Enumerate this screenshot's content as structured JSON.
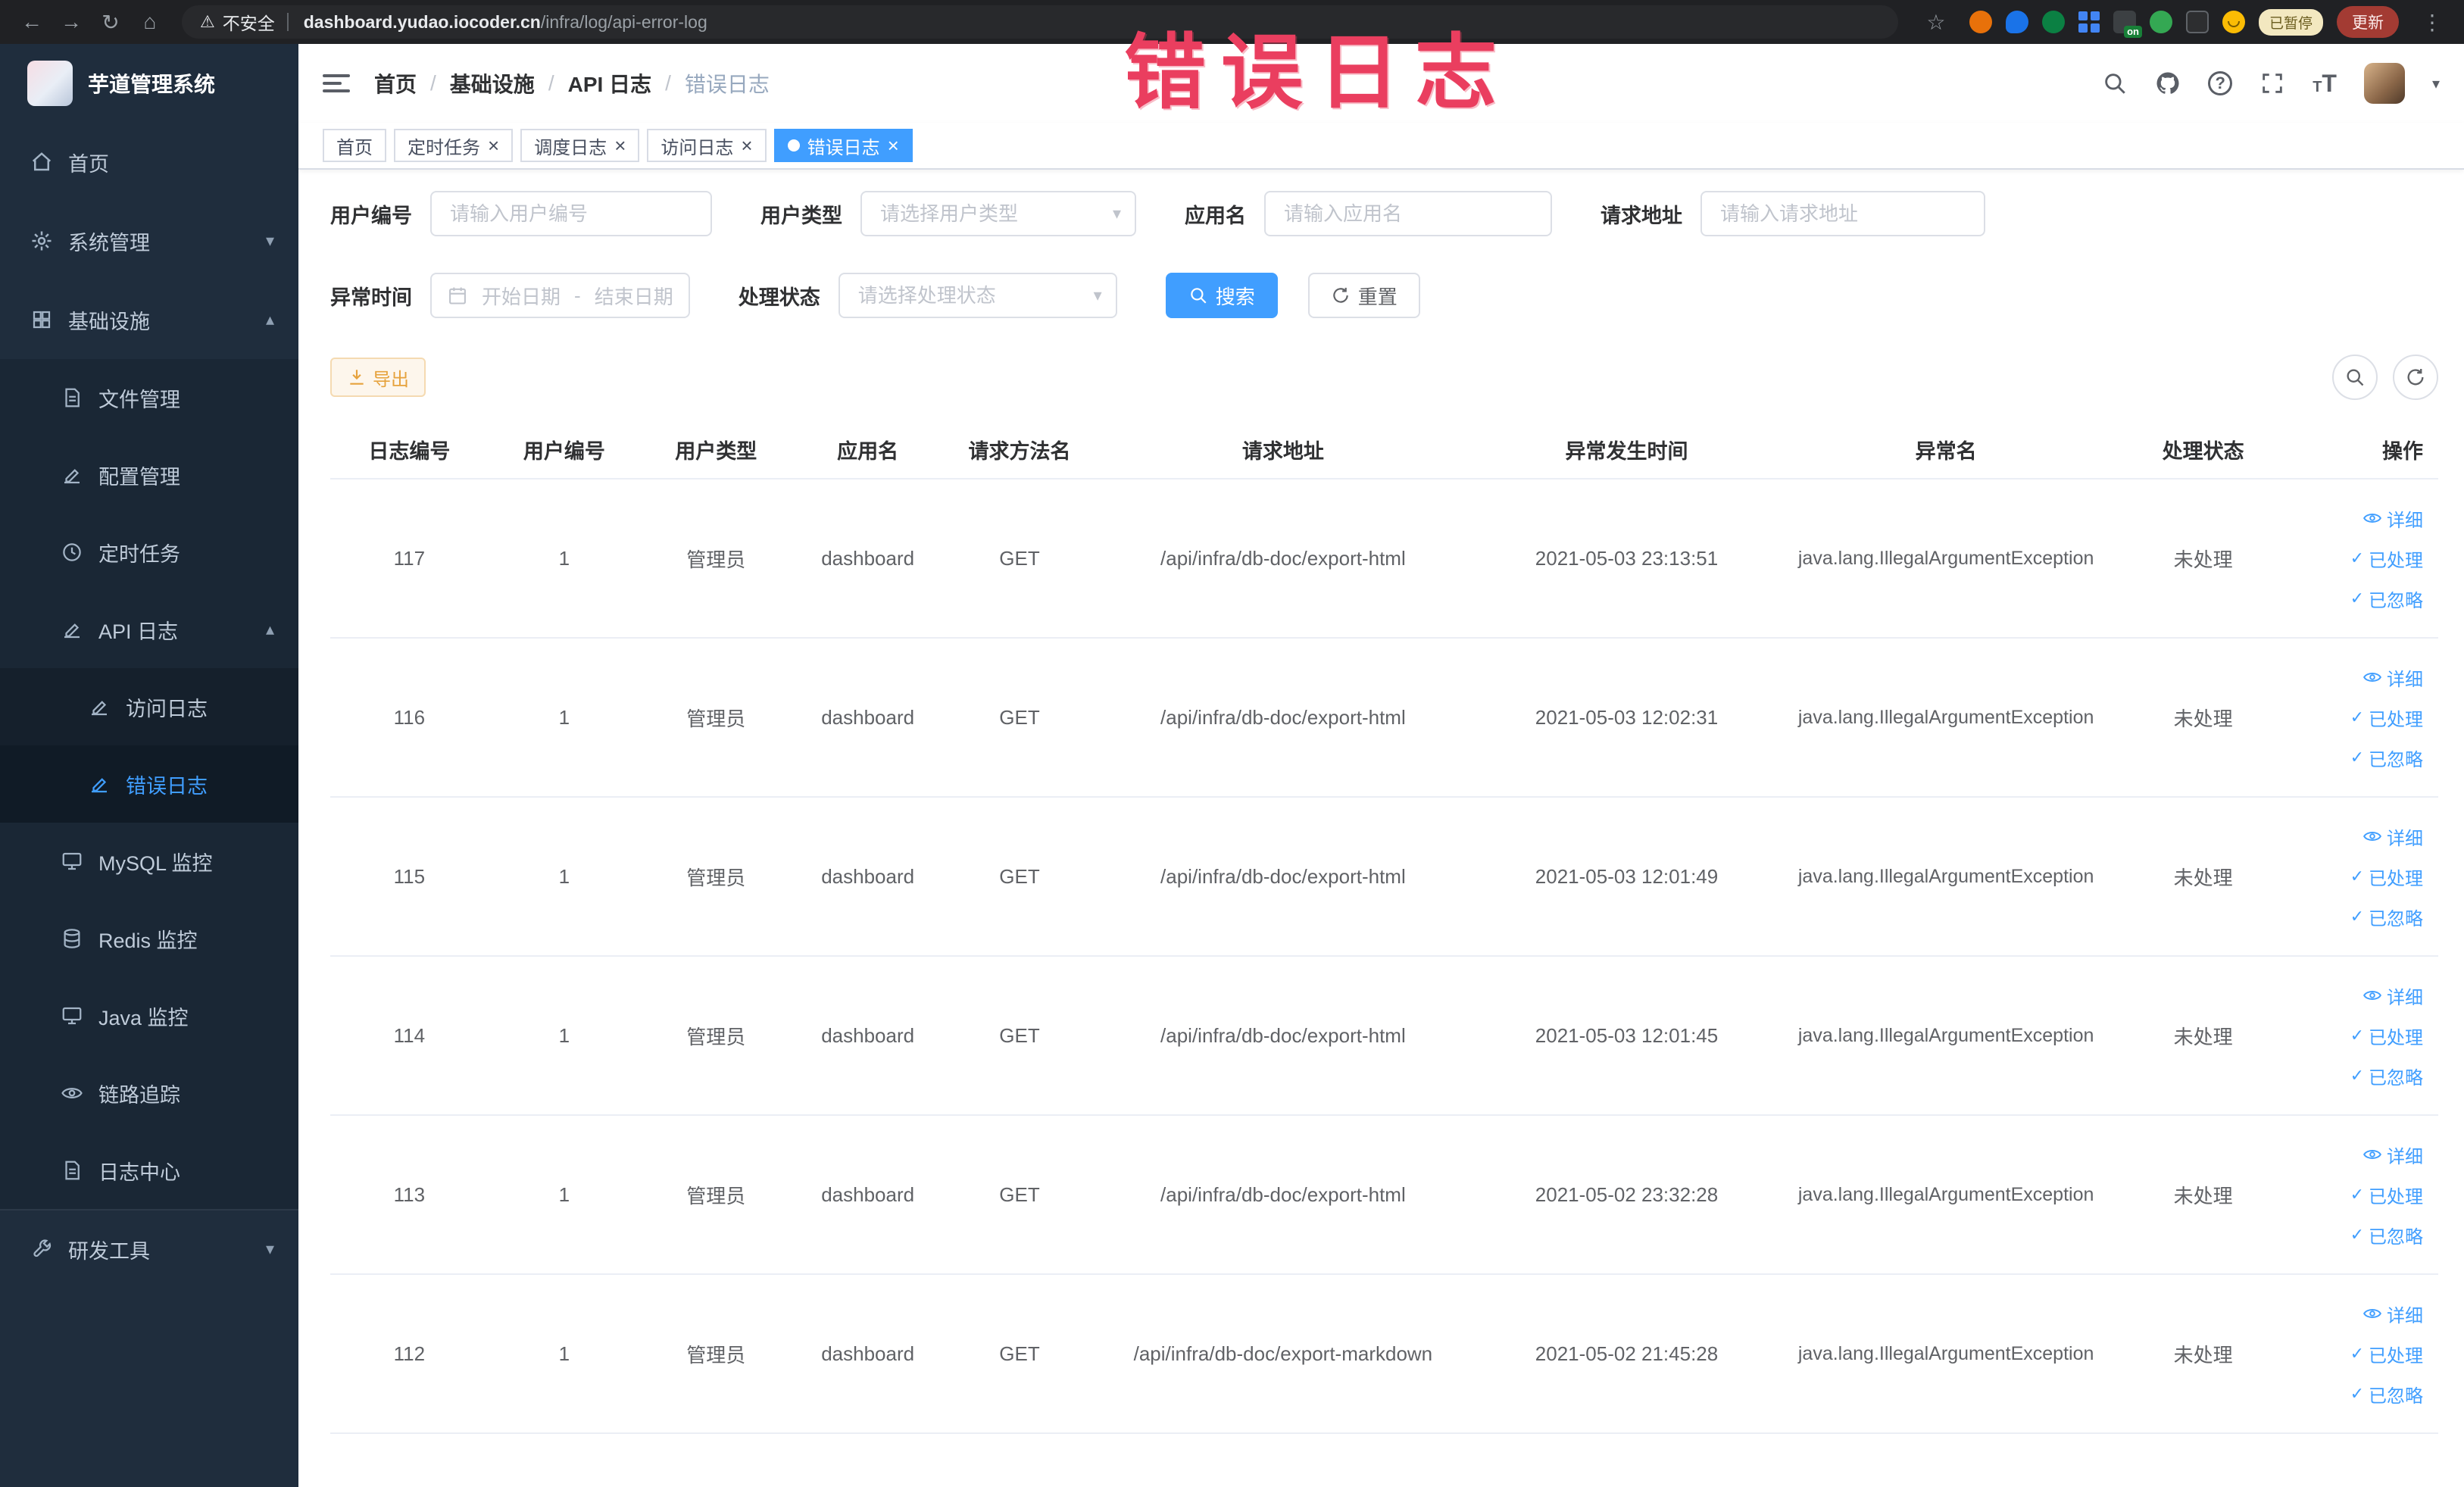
{
  "browser": {
    "security_warning": "不安全",
    "url_domain": "dashboard.yudao.iocoder.cn",
    "url_path": "/infra/log/api-error-log",
    "ext_on_badge": "on",
    "paused_badge": "已暂停",
    "update_button": "更新"
  },
  "annotation": {
    "text": "错误日志"
  },
  "colors": {
    "accent": "#409eff",
    "warning": "#e6a23c",
    "annotation": "#ea3e5f",
    "sidebar_bg": "#1f2d3d",
    "active_tab_bg": "#409eff"
  },
  "sidebar": {
    "logo_title": "芋道管理系统",
    "home": "首页",
    "system_mgmt": "系统管理",
    "infrastructure": "基础设施",
    "file_mgmt": "文件管理",
    "config_mgmt": "配置管理",
    "scheduled_jobs": "定时任务",
    "api_logs": "API 日志",
    "access_log": "访问日志",
    "error_log": "错误日志",
    "mysql_monitor": "MySQL 监控",
    "redis_monitor": "Redis 监控",
    "java_monitor": "Java 监控",
    "tracing": "链路追踪",
    "log_center": "日志中心",
    "dev_tools": "研发工具"
  },
  "breadcrumb": {
    "items": [
      "首页",
      "基础设施",
      "API 日志",
      "错误日志"
    ]
  },
  "tabs": [
    {
      "label": "首页",
      "closable": false,
      "active": false
    },
    {
      "label": "定时任务",
      "closable": true,
      "active": false
    },
    {
      "label": "调度日志",
      "closable": true,
      "active": false
    },
    {
      "label": "访问日志",
      "closable": true,
      "active": false
    },
    {
      "label": "错误日志",
      "closable": true,
      "active": true
    }
  ],
  "filters": {
    "user_id_label": "用户编号",
    "user_id_placeholder": "请输入用户编号",
    "user_type_label": "用户类型",
    "user_type_placeholder": "请选择用户类型",
    "app_name_label": "应用名",
    "app_name_placeholder": "请输入应用名",
    "request_url_label": "请求地址",
    "request_url_placeholder": "请输入请求地址",
    "exception_time_label": "异常时间",
    "date_start_placeholder": "开始日期",
    "date_separator": "-",
    "date_end_placeholder": "结束日期",
    "process_status_label": "处理状态",
    "process_status_placeholder": "请选择处理状态",
    "search_button": "搜索",
    "reset_button": "重置"
  },
  "toolbar": {
    "export_button": "导出"
  },
  "table": {
    "columns": [
      "日志编号",
      "用户编号",
      "用户类型",
      "应用名",
      "请求方法名",
      "请求地址",
      "异常发生时间",
      "异常名",
      "处理状态",
      "操作"
    ],
    "rows": [
      {
        "id": "117",
        "user_id": "1",
        "user_type": "管理员",
        "app_name": "dashboard",
        "method": "GET",
        "url": "/api/infra/db-doc/export-html",
        "time": "2021-05-03 23:13:51",
        "exception": "java.lang.IllegalArgumentException",
        "status": "未处理"
      },
      {
        "id": "116",
        "user_id": "1",
        "user_type": "管理员",
        "app_name": "dashboard",
        "method": "GET",
        "url": "/api/infra/db-doc/export-html",
        "time": "2021-05-03 12:02:31",
        "exception": "java.lang.IllegalArgumentException",
        "status": "未处理"
      },
      {
        "id": "115",
        "user_id": "1",
        "user_type": "管理员",
        "app_name": "dashboard",
        "method": "GET",
        "url": "/api/infra/db-doc/export-html",
        "time": "2021-05-03 12:01:49",
        "exception": "java.lang.IllegalArgumentException",
        "status": "未处理"
      },
      {
        "id": "114",
        "user_id": "1",
        "user_type": "管理员",
        "app_name": "dashboard",
        "method": "GET",
        "url": "/api/infra/db-doc/export-html",
        "time": "2021-05-03 12:01:45",
        "exception": "java.lang.IllegalArgumentException",
        "status": "未处理"
      },
      {
        "id": "113",
        "user_id": "1",
        "user_type": "管理员",
        "app_name": "dashboard",
        "method": "GET",
        "url": "/api/infra/db-doc/export-html",
        "time": "2021-05-02 23:32:28",
        "exception": "java.lang.IllegalArgumentException",
        "status": "未处理"
      },
      {
        "id": "112",
        "user_id": "1",
        "user_type": "管理员",
        "app_name": "dashboard",
        "method": "GET",
        "url": "/api/infra/db-doc/export-markdown",
        "time": "2021-05-02 21:45:28",
        "exception": "java.lang.IllegalArgumentException",
        "status": "未处理"
      }
    ]
  },
  "row_actions": {
    "detail": "详细",
    "process": "已处理",
    "ignore": "已忽略"
  },
  "icons": {
    "back": "←",
    "forward": "→",
    "reload": "↻",
    "home_glyph": "⌂",
    "warning": "⚠",
    "star": "☆",
    "more": "⋮",
    "caret_down": "▾",
    "caret_up": "▴",
    "check": "✓",
    "close": "×",
    "question": "?",
    "letter_t": "T",
    "sep": "/"
  }
}
